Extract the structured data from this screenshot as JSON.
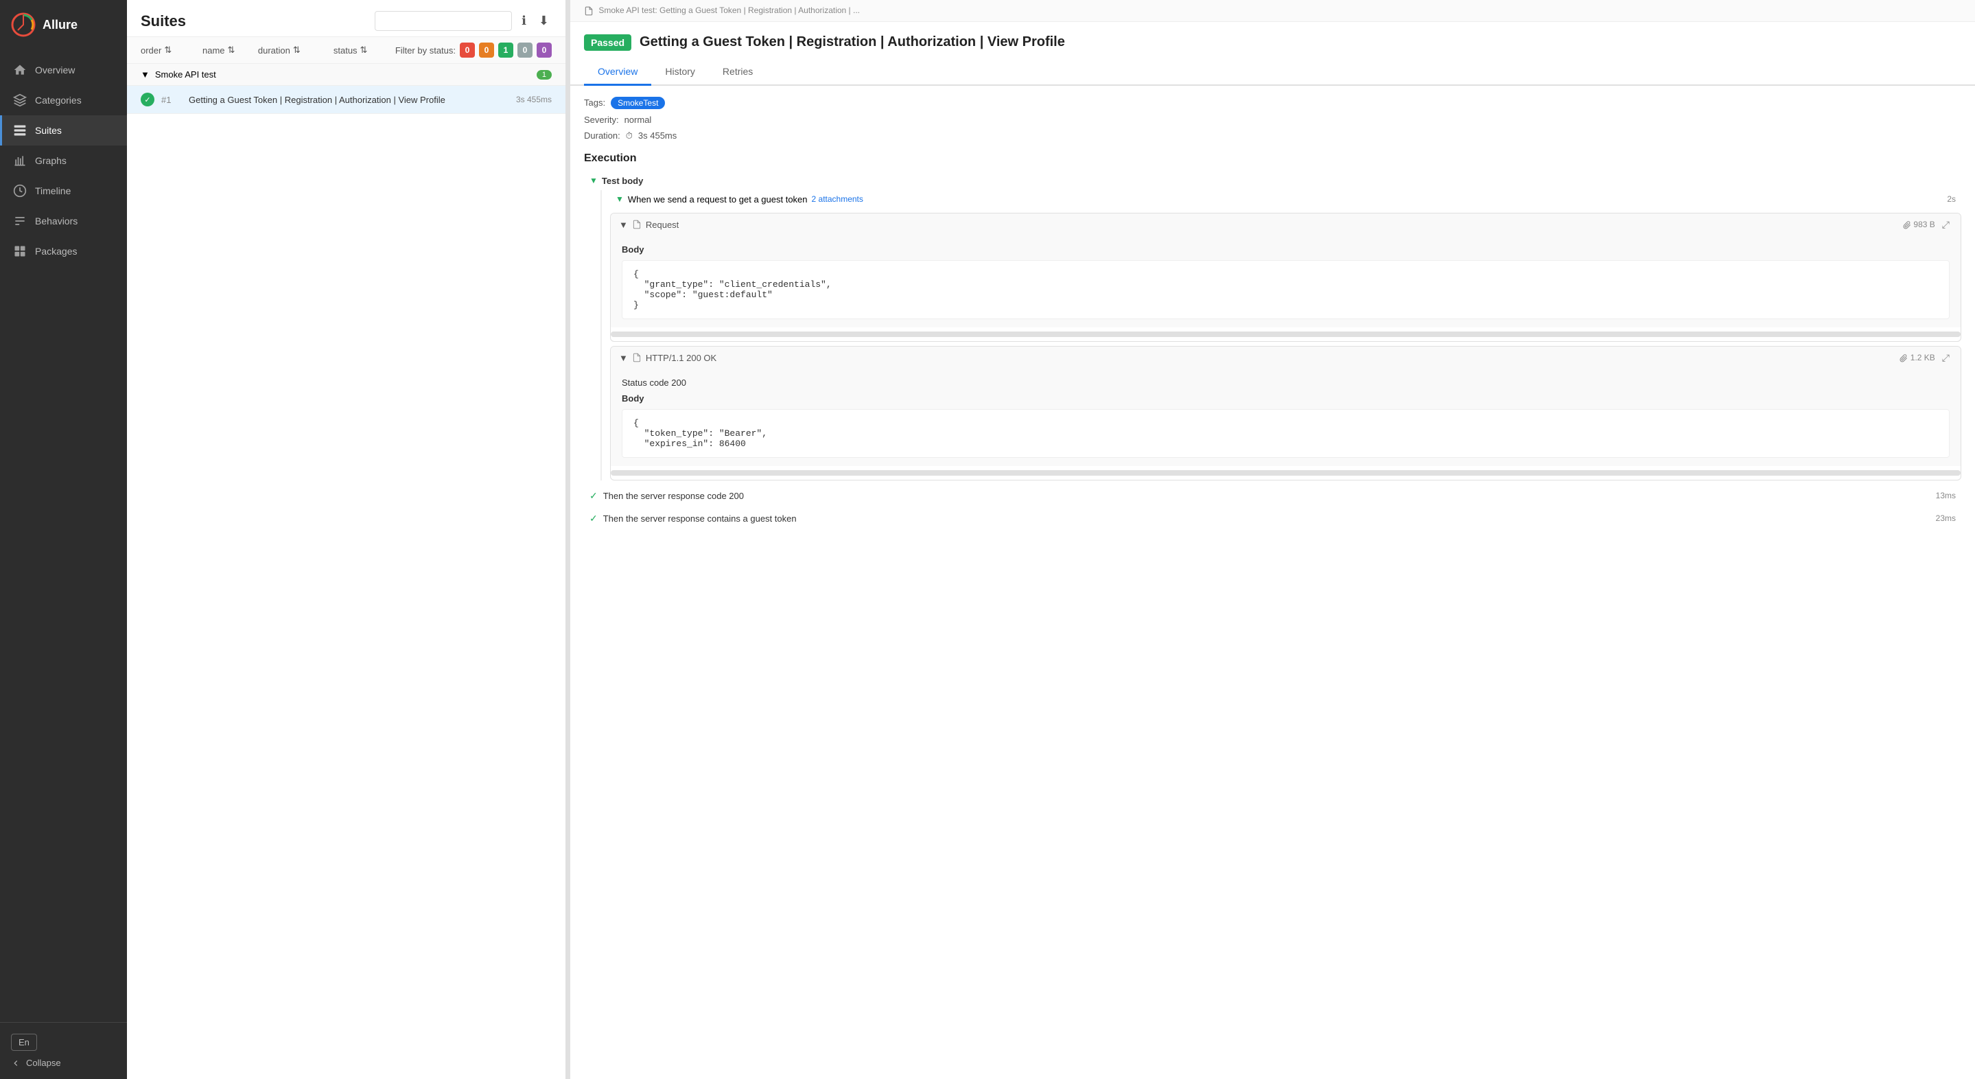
{
  "app": {
    "name": "Allure"
  },
  "sidebar": {
    "items": [
      {
        "id": "overview",
        "label": "Overview",
        "icon": "home"
      },
      {
        "id": "categories",
        "label": "Categories",
        "icon": "categories"
      },
      {
        "id": "suites",
        "label": "Suites",
        "icon": "suites",
        "active": true
      },
      {
        "id": "graphs",
        "label": "Graphs",
        "icon": "graphs"
      },
      {
        "id": "timeline",
        "label": "Timeline",
        "icon": "timeline"
      },
      {
        "id": "behaviors",
        "label": "Behaviors",
        "icon": "behaviors"
      },
      {
        "id": "packages",
        "label": "Packages",
        "icon": "packages"
      }
    ],
    "lang": "En",
    "collapse_label": "Collapse"
  },
  "suites": {
    "title": "Suites",
    "search_placeholder": "",
    "columns": {
      "order": "order",
      "name": "name",
      "duration": "duration",
      "status": "status"
    },
    "filter_label": "Filter by status:",
    "filter_counts": [
      0,
      0,
      1,
      0,
      0
    ],
    "groups": [
      {
        "name": "Smoke API test",
        "count": 1,
        "tests": [
          {
            "num": "#1",
            "name": "Getting a Guest Token | Registration | Authorization | View Profile",
            "duration": "3s 455ms",
            "status": "passed"
          }
        ]
      }
    ]
  },
  "detail": {
    "breadcrumb": "Smoke API test: Getting a Guest Token | Registration | Authorization | ...",
    "status": "Passed",
    "title": "Getting a Guest Token | Registration | Authorization | View Profile",
    "tabs": [
      "Overview",
      "History",
      "Retries"
    ],
    "active_tab": "Overview",
    "tags_label": "Tags:",
    "tag": "SmokeTest",
    "severity_label": "Severity:",
    "severity": "normal",
    "duration_label": "Duration:",
    "duration_icon": "⏱",
    "duration": "3s 455ms",
    "execution_title": "Execution",
    "test_body_label": "Test body",
    "steps": [
      {
        "label": "When we send a request to get a guest token",
        "attachments_count": "2 attachments",
        "duration": "2s",
        "expanded": true,
        "sub_items": [
          {
            "type": "request",
            "label": "Request",
            "size": "983 B",
            "body_label": "Body",
            "code": "{\n  \"grant_type\": \"client_credentials\",\n  \"scope\": \"guest:default\"\n}"
          },
          {
            "type": "response",
            "label": "HTTP/1.1 200 OK",
            "size": "1.2 KB",
            "status_code_label": "Status code 200",
            "body_label": "Body",
            "code": "{\n  \"token_type\": \"Bearer\",\n  \"expires_in\": 86400"
          }
        ]
      }
    ],
    "check_steps": [
      {
        "label": "Then the server response code 200",
        "duration": "13ms"
      },
      {
        "label": "Then the server response contains a guest token",
        "duration": "23ms"
      }
    ]
  }
}
